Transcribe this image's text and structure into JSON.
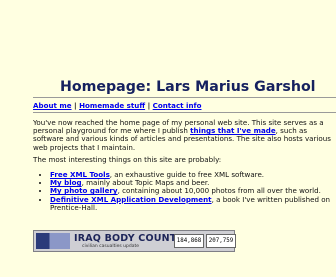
{
  "page": {
    "title": "Homepage: Lars Marius Garshol"
  },
  "nav": {
    "items": [
      "About me",
      "Homemade stuff",
      "Contact info"
    ],
    "separator": "|"
  },
  "intro": {
    "before_link": "You've now reached the home page of my personal web site. This site serves as a personal playground for me where I publish ",
    "link": "things that I've made",
    "after_link": ", such as software and various kinds of articles and presentations. The site also hosts various web projects that I maintain."
  },
  "lead": "The most interesting things on this site are probably:",
  "list": [
    {
      "link": "Free XML Tools",
      "text": ", an exhaustive guide to free XML software."
    },
    {
      "link": "My blog",
      "text": ", mainly about Topic Maps and beer."
    },
    {
      "link": "My photo gallery",
      "text": ", containing about 10,000 photos from all over the world."
    },
    {
      "link": "Definitive XML Application Development",
      "text": ", a book I've written published on Prentice-Hall."
    }
  ],
  "banner": {
    "title": "IRAQ BODY COUNT",
    "subtitle": "civilian casualties update",
    "count_min": "184,868",
    "count_max": "207,759"
  }
}
